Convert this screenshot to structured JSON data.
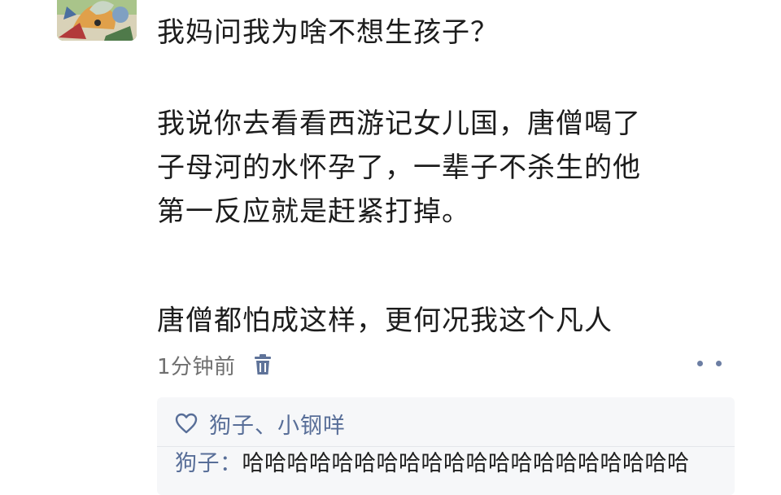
{
  "post": {
    "lines": [
      "我妈问我为啥不想生孩子？",
      "",
      "我说你去看看西游记女儿国，唐僧喝了",
      "子母河的水怀孕了，一辈子不杀生的他",
      "第一反应就是赶紧打掉。",
      "",
      "唐僧都怕成这样，更何况我这个凡人"
    ],
    "time": "1分钟前"
  },
  "likes": {
    "names": "狗子、小钢咩"
  },
  "comments": [
    {
      "author": "狗子",
      "separator": "：",
      "text": "哈哈哈哈哈哈哈哈哈哈哈哈哈哈哈哈哈哈哈哈"
    }
  ],
  "icons": {
    "delete": "trash-icon",
    "like": "heart-icon",
    "more": "more-dots-icon"
  },
  "colors": {
    "link": "#586e98",
    "meta": "#6f6f6f",
    "comment_bg": "#f6f7f9"
  }
}
